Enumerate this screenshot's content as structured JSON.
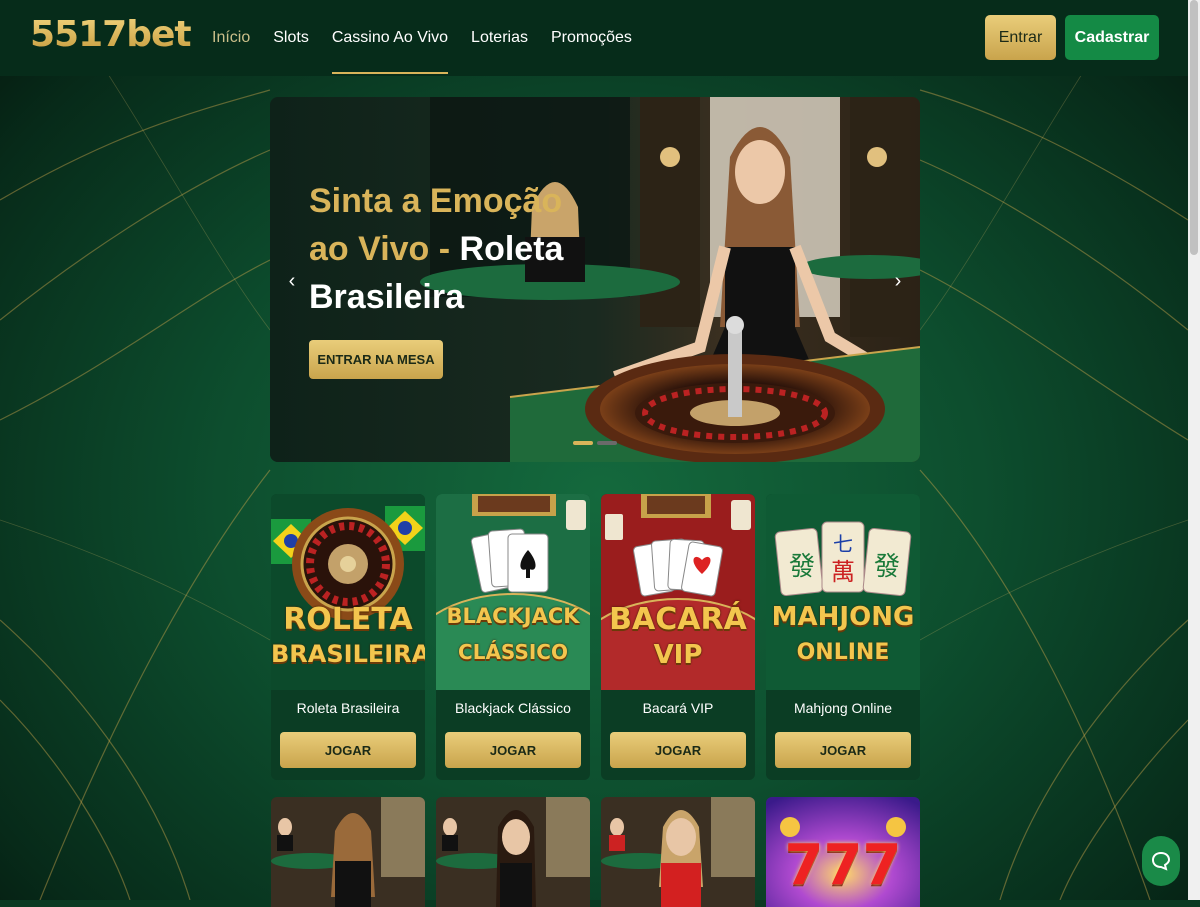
{
  "brand": {
    "logo_text": "5517bet",
    "gold": "#d9b45a",
    "green": "#148a45"
  },
  "nav": {
    "items": [
      {
        "label": "Início"
      },
      {
        "label": "Slots"
      },
      {
        "label": "Cassino Ao Vivo"
      },
      {
        "label": "Loterias"
      },
      {
        "label": "Promoções"
      }
    ],
    "active_index": 2
  },
  "auth": {
    "login_label": "Entrar",
    "register_label": "Cadastrar"
  },
  "hero": {
    "title_part1": "Sinta a Emoção ao Vivo - ",
    "title_part2": "Roleta Brasileira",
    "cta_label": "ENTRAR NA MESA",
    "prev_icon": "chevron-left-icon",
    "next_icon": "chevron-right-icon",
    "slide_count": 2,
    "active_slide": 1
  },
  "games": [
    {
      "art_line1": "ROLETA",
      "art_line2": "BRASILEIRA",
      "name": "Roleta Brasileira",
      "button": "JOGAR"
    },
    {
      "art_line1": "BLACKJACK",
      "art_line2": "CLÁSSICO",
      "name": "Blackjack Clássico",
      "button": "JOGAR"
    },
    {
      "art_line1": "BACARÁ",
      "art_line2": "VIP",
      "name": "Bacará VIP",
      "button": "JOGAR"
    },
    {
      "art_line1": "MAHJONG",
      "art_line2": "ONLINE",
      "name": "Mahjong Online",
      "button": "JOGAR"
    }
  ],
  "second_row_art": {
    "slot_text": "777"
  },
  "mahjong_tiles": [
    "發",
    "七",
    "發"
  ],
  "mahjong_tile_sub": "萬",
  "chat": {
    "icon": "chat-icon"
  }
}
